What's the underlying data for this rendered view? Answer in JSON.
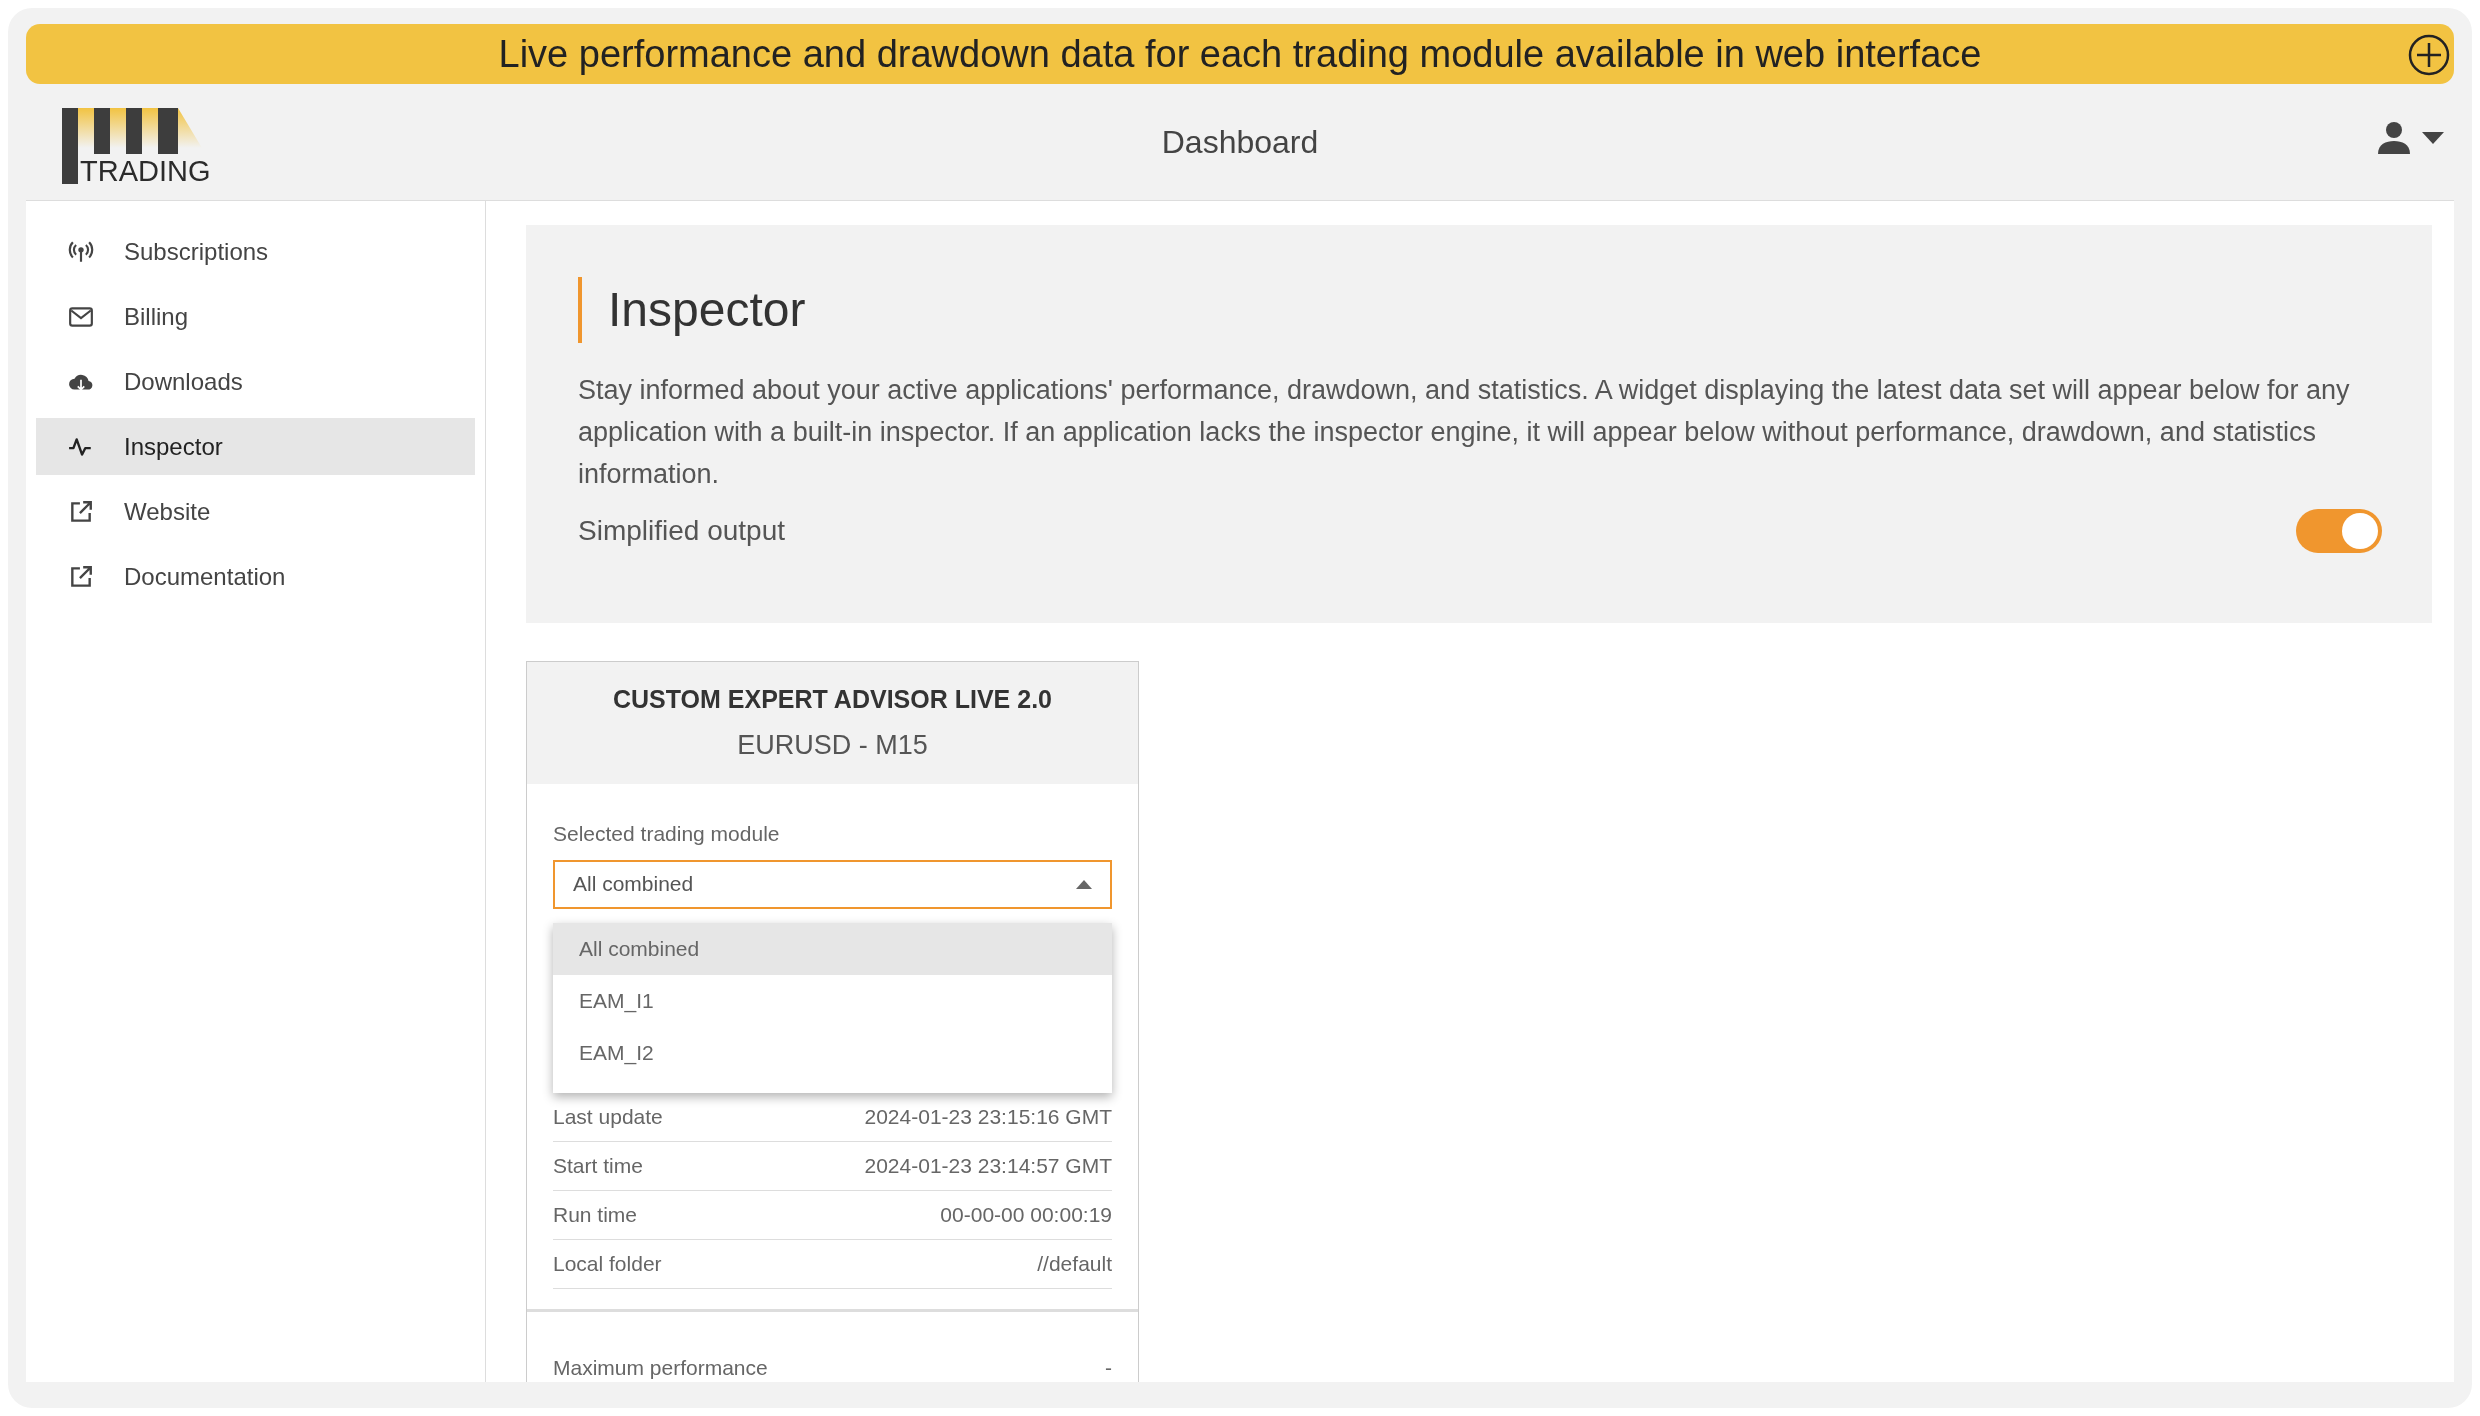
{
  "banner": {
    "text": "Live performance and drawdown data for each trading module available in web interface"
  },
  "header": {
    "logo_text": "TRADING",
    "title": "Dashboard"
  },
  "sidebar": {
    "items": [
      {
        "label": "Subscriptions",
        "kind": "antenna",
        "selected": false
      },
      {
        "label": "Billing",
        "kind": "mail",
        "selected": false
      },
      {
        "label": "Downloads",
        "kind": "cloud",
        "selected": false
      },
      {
        "label": "Inspector",
        "kind": "pulse",
        "selected": true
      },
      {
        "label": "Website",
        "kind": "external",
        "selected": false
      },
      {
        "label": "Documentation",
        "kind": "external",
        "selected": false
      }
    ]
  },
  "intro": {
    "title": "Inspector",
    "text": "Stay informed about your active applications' performance, drawdown, and statistics. A widget displaying the latest data set will appear below for any application with a built-in inspector. If an application lacks the inspector engine, it will appear below without performance, drawdown, and statistics information.",
    "toggle_label": "Simplified output",
    "toggle_on": true
  },
  "card": {
    "title": "CUSTOM EXPERT ADVISOR LIVE 2.0",
    "subtitle": "EURUSD - M15",
    "select_label": "Selected trading module",
    "select_value": "All combined",
    "dropdown_expanded": true,
    "options": [
      {
        "label": "All combined",
        "selected": true
      },
      {
        "label": "EAM_I1",
        "selected": false
      },
      {
        "label": "EAM_I2",
        "selected": false
      }
    ],
    "rows": [
      {
        "label": "Last update",
        "value": "2024-01-23 23:15:16 GMT"
      },
      {
        "label": "Start time",
        "value": "2024-01-23 23:14:57 GMT"
      },
      {
        "label": "Run time",
        "value": "00-00-00 00:00:19"
      },
      {
        "label": "Local folder",
        "value": "//default"
      }
    ],
    "stats": [
      {
        "label": "Maximum performance",
        "value": "-"
      }
    ]
  }
}
